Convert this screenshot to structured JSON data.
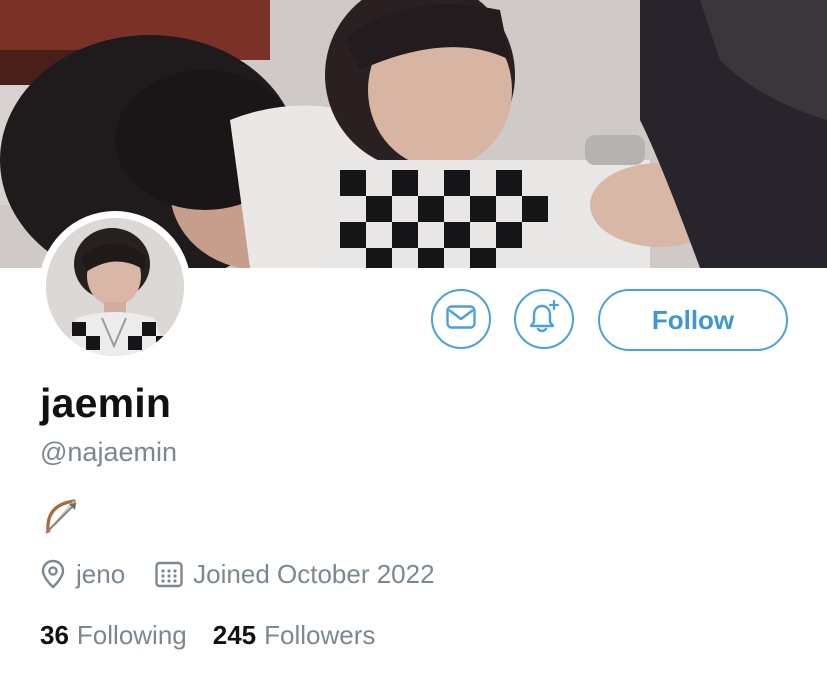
{
  "profile": {
    "display_name": "jaemin",
    "handle": "@najaemin",
    "bio_emoji": "bow-and-arrow",
    "location": "jeno",
    "joined": "Joined October 2022"
  },
  "actions": {
    "message_icon": "envelope-icon",
    "notify_icon": "bell-plus-icon",
    "follow_label": "Follow"
  },
  "stats": {
    "following_count": "36",
    "following_label": "Following",
    "followers_count": "245",
    "followers_label": "Followers"
  },
  "colors": {
    "accent": "#4aa2dd",
    "text_primary": "#111111",
    "text_secondary": "#7c8791"
  }
}
